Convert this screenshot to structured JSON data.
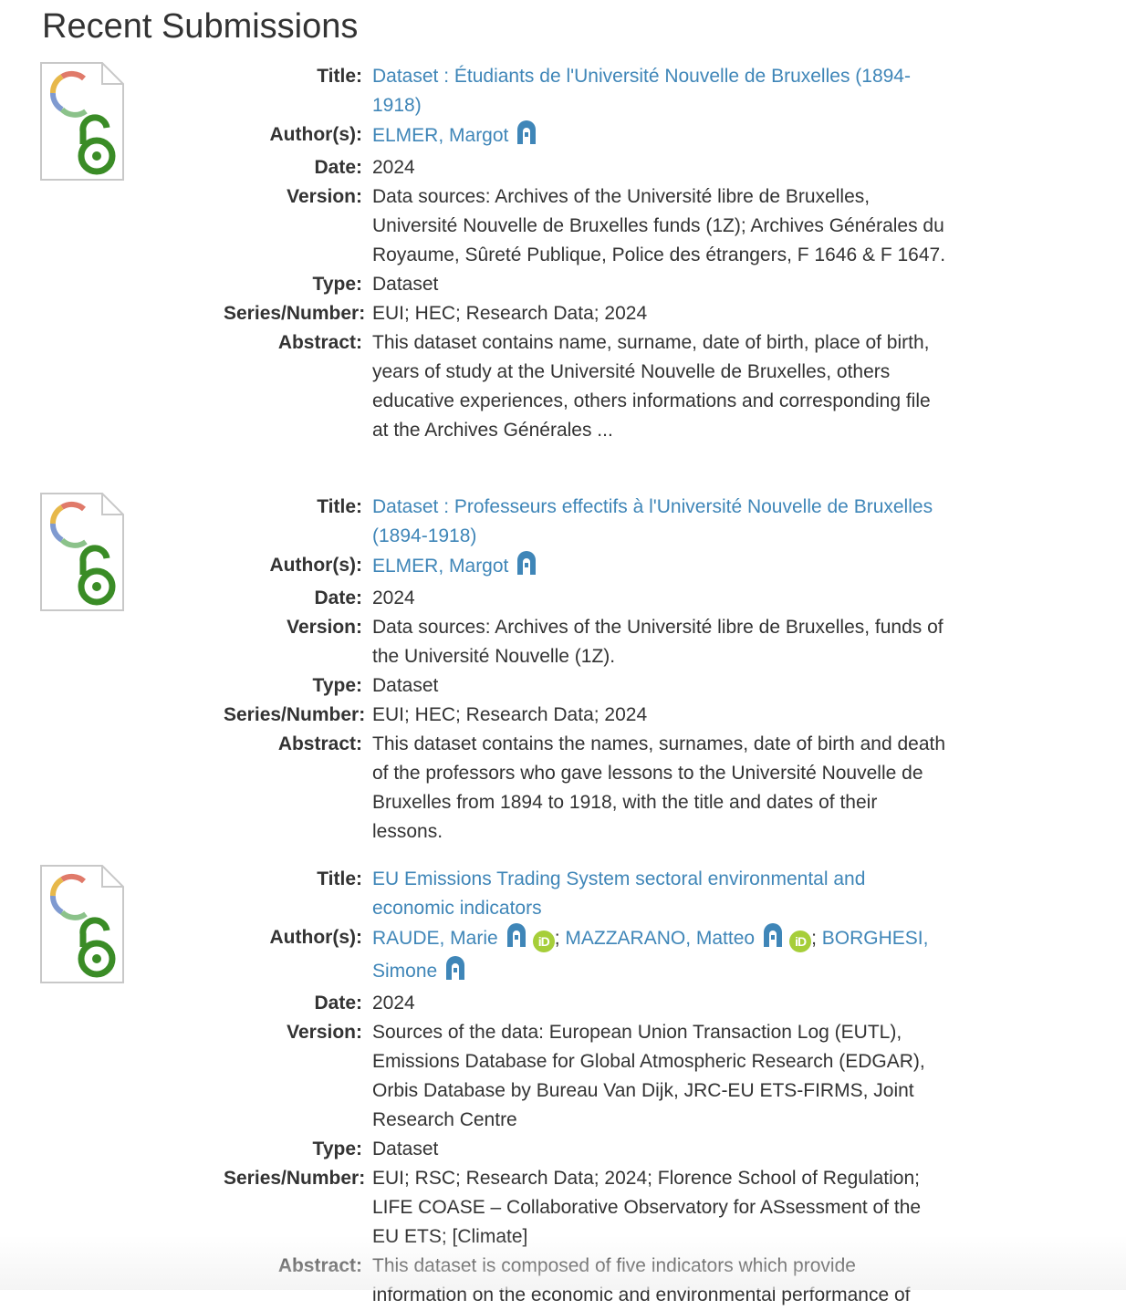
{
  "page": {
    "heading": "Recent Submissions"
  },
  "labels": {
    "title": "Title:",
    "authors": "Author(s):",
    "date": "Date:",
    "version": "Version:",
    "type": "Type:",
    "series": "Series/Number:",
    "abstract": "Abstract:"
  },
  "items": [
    {
      "thumbnail_icon": "open-access-document-icon",
      "title": "Dataset : Étudiants de l'Université Nouvelle de Bruxelles (1894-1918)",
      "authors": [
        {
          "name": "ELMER, Margot",
          "repository_icon": true,
          "orcid": false
        }
      ],
      "date": "2024",
      "version": "Data sources: Archives of the Université libre de Bruxelles, Université Nouvelle de Bruxelles funds (1Z); Archives Générales du Royaume, Sûreté Publique, Police des étrangers, F 1646 & F 1647.",
      "type": "Dataset",
      "series": "EUI; HEC; Research Data; 2024",
      "abstract": "This dataset contains name, surname, date of birth, place of birth, years of study at the Université Nouvelle de Bruxelles, others educative experiences, others informations and corresponding file at the Archives Générales ..."
    },
    {
      "thumbnail_icon": "open-access-document-icon",
      "title": "Dataset : Professeurs effectifs à l'Université Nouvelle de Bruxelles (1894-1918)",
      "authors": [
        {
          "name": "ELMER, Margot",
          "repository_icon": true,
          "orcid": false
        }
      ],
      "date": "2024",
      "version": "Data sources: Archives of the Université libre de Bruxelles, funds of the Université Nouvelle (1Z).",
      "type": "Dataset",
      "series": "EUI; HEC; Research Data; 2024",
      "abstract": "This dataset contains the names, surnames, date of birth and death of the professors who gave lessons to the Université Nouvelle de Bruxelles from 1894 to 1918, with the title and dates of their lessons."
    },
    {
      "thumbnail_icon": "open-access-document-icon",
      "title": "EU Emissions Trading System sectoral environmental and economic indicators",
      "authors": [
        {
          "name": "RAUDE, Marie",
          "repository_icon": true,
          "orcid": true
        },
        {
          "name": "MAZZARANO, Matteo",
          "repository_icon": true,
          "orcid": true
        },
        {
          "name": "BORGHESI, Simone",
          "repository_icon": true,
          "orcid": false
        }
      ],
      "author_separator": "; ",
      "orcid_label": "iD",
      "date": "2024",
      "version": "Sources of the data: European Union Transaction Log (EUTL), Emissions Database for Global Atmospheric Research (EDGAR), Orbis Database by Bureau Van Dijk, JRC-EU ETS-FIRMS, Joint Research Centre",
      "type": "Dataset",
      "series": "EUI; RSC; Research Data; 2024; Florence School of Regulation; LIFE COASE – Collaborative Observatory for ASsessment of the EU ETS; [Climate]",
      "abstract": "This dataset is composed of five indicators which provide information on the economic and environmental performance of"
    }
  ],
  "colors": {
    "link": "#3f86b8",
    "text": "#333333",
    "open_access_green": "#3a8c26",
    "orcid_green": "#a6ce39",
    "repository_blue": "#3f86b8"
  }
}
